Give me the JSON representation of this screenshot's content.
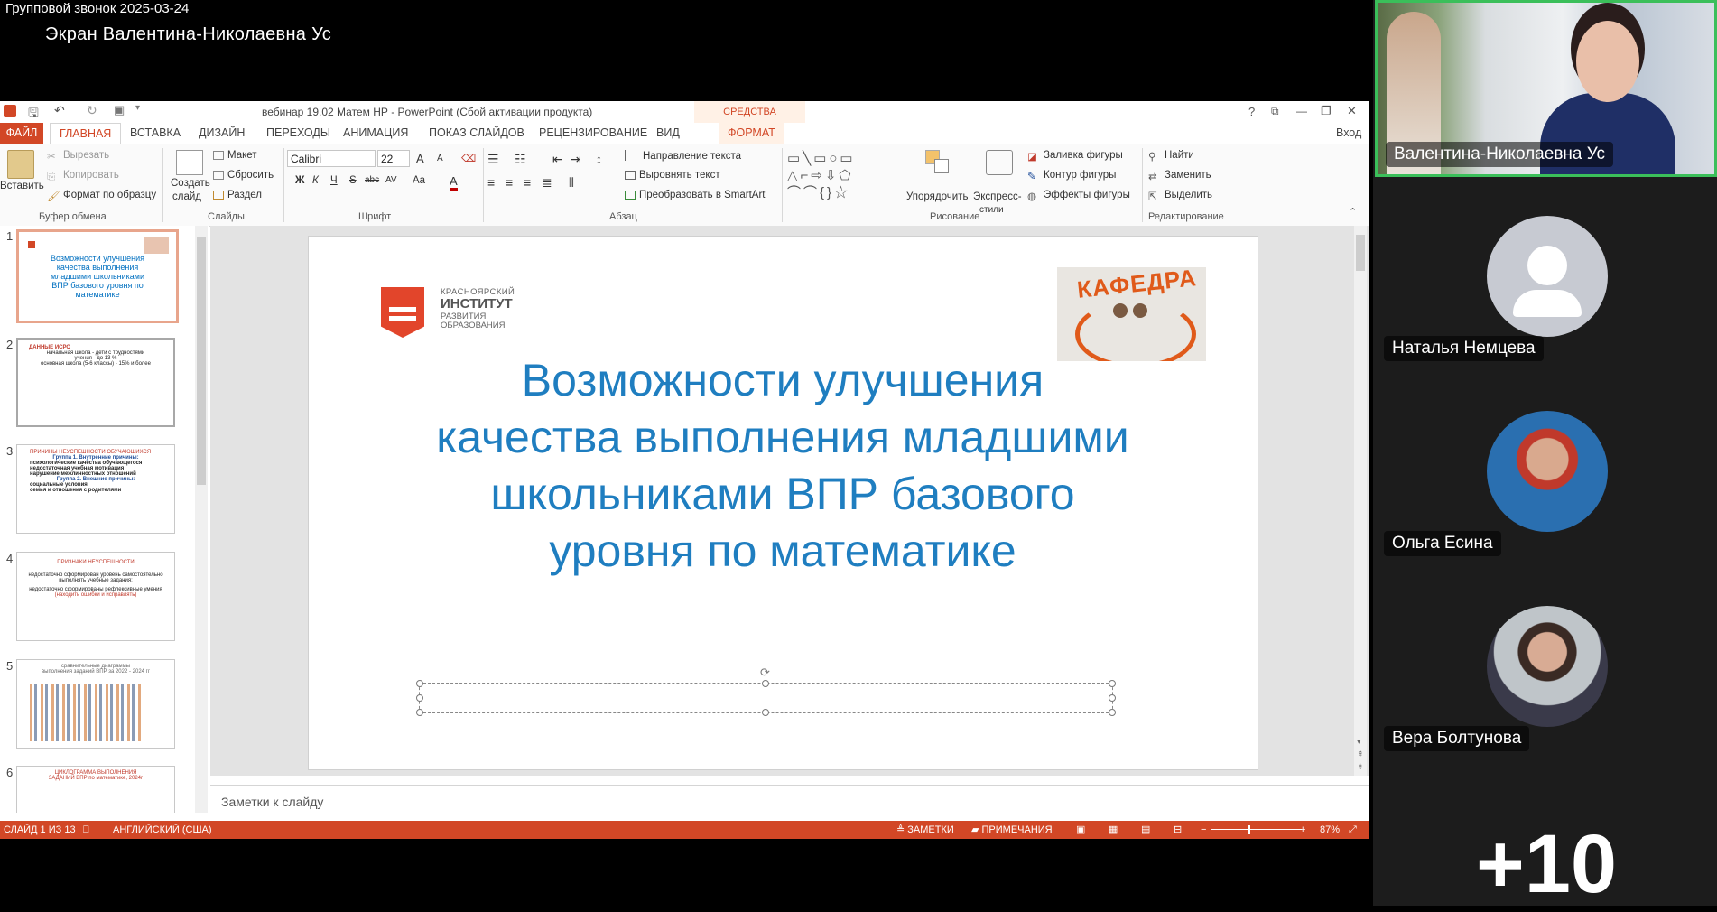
{
  "call": {
    "title": "Групповой звонок 2025-03-24",
    "screen_label": "Экран Валентина-Николаевна Ус",
    "participants": [
      {
        "name": "Валентина-Николаевна Ус"
      },
      {
        "name": "Наталья Немцева"
      },
      {
        "name": "Ольга Есина"
      },
      {
        "name": "Вера Болтунова"
      }
    ],
    "more_count": "+10",
    "accent_color": "#3bbf5a"
  },
  "ppt": {
    "window_title": "вебинар 19.02 Матем НР - PowerPoint (Сбой активации продукта)",
    "drawing_tools_header": "СРЕДСТВА РИСОВАНИЯ",
    "window_controls": [
      "?",
      "⧉",
      "—",
      "❐",
      "✕"
    ],
    "signin": "Вход",
    "tabs": {
      "file": "ФАЙЛ",
      "home": "ГЛАВНАЯ",
      "insert": "ВСТАВКА",
      "design": "ДИЗАЙН",
      "transitions": "ПЕРЕХОДЫ",
      "animation": "АНИМАЦИЯ",
      "slideshow": "ПОКАЗ СЛАЙДОВ",
      "review": "РЕЦЕНЗИРОВАНИЕ",
      "view": "ВИД",
      "format": "ФОРМАТ"
    },
    "ribbon": {
      "clipboard": {
        "paste": "Вставить",
        "cut": "Вырезать",
        "copy": "Копировать",
        "format_painter": "Формат по образцу",
        "label": "Буфер обмена"
      },
      "slides": {
        "create": "Создать",
        "slide": "слайд",
        "layout": "Макет",
        "reset": "Сбросить",
        "section": "Раздел",
        "label": "Слайды"
      },
      "font": {
        "name": "Calibri",
        "size": "22",
        "label": "Шрифт",
        "bold": "Ж",
        "italic": "К",
        "underline": "Ч",
        "strike": "S",
        "abc": "abc",
        "spacing": "AV",
        "case": "Aa",
        "grow": "A",
        "shrink": "A",
        "color": "A"
      },
      "paragraph": {
        "text_direction": "Направление текста",
        "align_text": "Выровнять текст",
        "smartart": "Преобразовать в SmartArt",
        "label": "Абзац"
      },
      "drawing": {
        "arrange": "Упорядочить",
        "quick_styles": "Экспресс-",
        "quick_styles2": "стили",
        "fill": "Заливка фигуры",
        "outline": "Контур фигуры",
        "effects": "Эффекты фигуры",
        "label": "Рисование"
      },
      "editing": {
        "find": "Найти",
        "replace": "Заменить",
        "select": "Выделить",
        "label": "Редактирование"
      }
    },
    "thumbnails": [
      {
        "num": "1",
        "lines": [
          "Возможности улучшения",
          "качества выполнения",
          "младшими школьниками",
          "ВПР базового уровня по",
          "математике"
        ]
      },
      {
        "num": "2",
        "lines": [
          "ДАННЫЕ ИСРО",
          "начальная школа - дети с трудностями",
          "учения - до 13 %",
          "основная школа (5-6 классы) - 15% и более"
        ]
      },
      {
        "num": "3",
        "lines": [
          "ПРИЧИНЫ НЕУСПЕШНОСТИ ОБУЧАЮЩИХСЯ",
          "Группа 1. Внутренние причины:",
          "психологические качества обучающегося",
          "недостаточная учебная мотивация",
          "нарушение межличностных отношений",
          "Группа 2. Внешние причины:",
          "социальные условия",
          "семья и отношения с родителями"
        ]
      },
      {
        "num": "4",
        "lines": [
          "ПРИЗНАКИ НЕУСПЕШНОСТИ",
          "недостаточно сформирован уровень самостоятельно",
          "выполнять учебные задания;",
          "недостаточно сформированы рефлексивные умения",
          "(находить ошибки и исправлять)"
        ]
      },
      {
        "num": "5",
        "lines": [
          "сравнительные диаграммы",
          "выполнения заданий ВПР за 2022 - 2024 гг"
        ]
      },
      {
        "num": "6",
        "lines": [
          "ЦИКЛОГРАММА ВЫПОЛНЕНИЯ",
          "ЗАДАНИЙ ВПР по математике, 2024г"
        ]
      }
    ],
    "slide": {
      "title": "Возможности улучшения качества выполнения младшими школьниками ВПР базового уровня по математике",
      "logo_lines": [
        "КРАСНОЯРСКИЙ",
        "ИНСТИТУТ",
        "РАЗВИТИЯ",
        "ОБРАЗОВАНИЯ"
      ],
      "kafedra_text": "КАФЕДРА",
      "title_color": "#1f7ec0"
    },
    "notes_placeholder": "Заметки к слайду",
    "status": {
      "slide_of": "СЛАЙД 1 ИЗ 13",
      "language": "АНГЛИЙСКИЙ (США)",
      "notes": "ЗАМЕТКИ",
      "comments": "ПРИМЕЧАНИЯ",
      "zoom": "87%",
      "accent_color": "#d24726"
    }
  }
}
